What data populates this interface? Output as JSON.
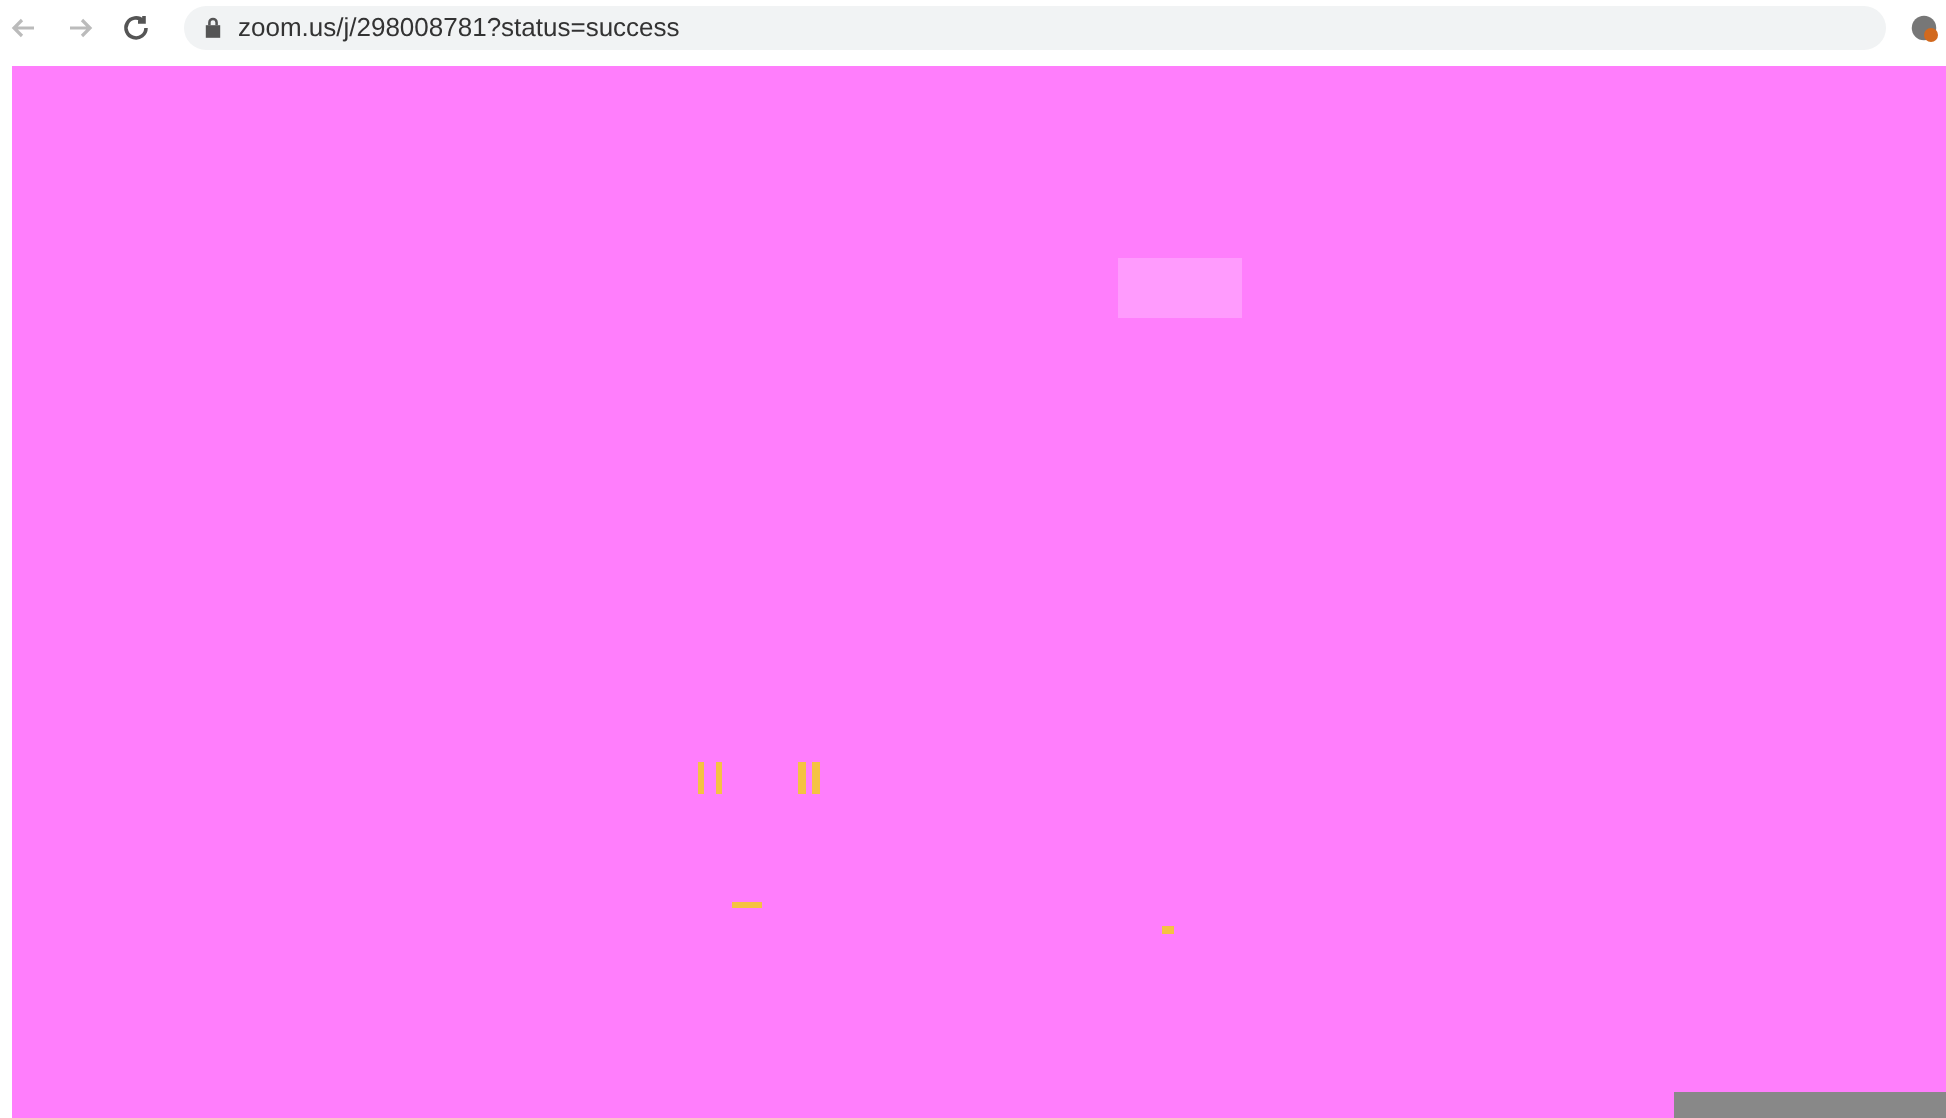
{
  "browser": {
    "url": "zoom.us/j/298008781?status=success"
  }
}
